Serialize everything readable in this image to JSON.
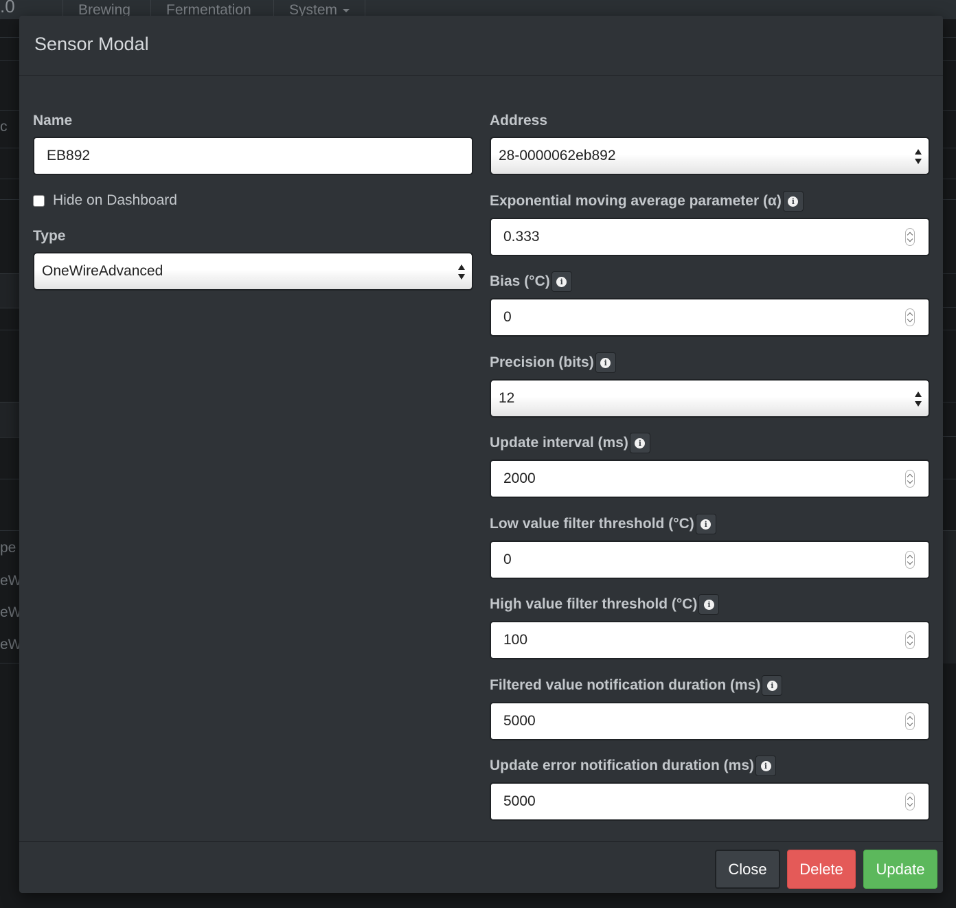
{
  "background": {
    "brand_fragment": ".0",
    "nav_items": [
      "Brewing",
      "Fermentation",
      "System"
    ],
    "left_fragments": [
      "c",
      "pe",
      "eW",
      "eW",
      "eW"
    ]
  },
  "modal": {
    "title": "Sensor Modal",
    "left": {
      "name_label": "Name",
      "name_value": "EB892",
      "hide_label": "Hide on Dashboard",
      "hide_checked": false,
      "type_label": "Type",
      "type_value": "OneWireAdvanced"
    },
    "right": {
      "address_label": "Address",
      "address_value": "28-0000062eb892",
      "fields": [
        {
          "label": "Exponential moving average parameter (α)",
          "value": "0.333",
          "kind": "number"
        },
        {
          "label": "Bias (°C)",
          "value": "0",
          "kind": "number"
        },
        {
          "label": "Precision (bits)",
          "value": "12",
          "kind": "select"
        },
        {
          "label": "Update interval (ms)",
          "value": "2000",
          "kind": "number"
        },
        {
          "label": "Low value filter threshold (°C)",
          "value": "0",
          "kind": "number"
        },
        {
          "label": "High value filter threshold (°C)",
          "value": "100",
          "kind": "number"
        },
        {
          "label": "Filtered value notification duration (ms)",
          "value": "5000",
          "kind": "number"
        },
        {
          "label": "Update error notification duration (ms)",
          "value": "5000",
          "kind": "number"
        }
      ]
    },
    "info_icon": "info-circle-icon",
    "footer": {
      "close_label": "Close",
      "delete_label": "Delete",
      "update_label": "Update"
    },
    "colors": {
      "modal_bg": "#2f3337",
      "delete": "#e45a58",
      "update": "#5cb85c",
      "close": "#3c4146"
    }
  }
}
